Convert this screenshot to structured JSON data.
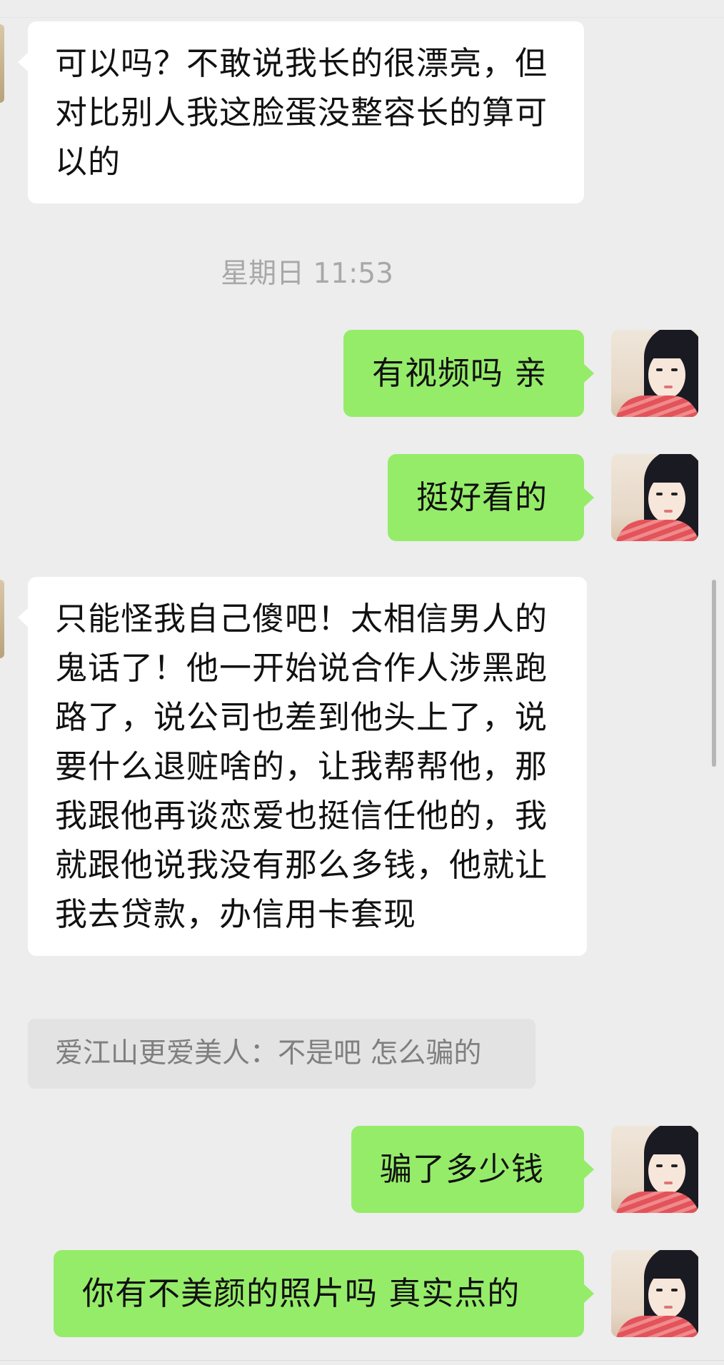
{
  "messages": {
    "m1": "可以吗？不敢说我长的很漂亮，但对比别人我这脸蛋没整容长的算可以的",
    "timestamp": "星期日 11:53",
    "m2": "有视频吗 亲",
    "m3": "挺好看的",
    "m4": "只能怪我自己傻吧！太相信男人的鬼话了！他一开始说合作人涉黑跑路了，说公司也差到他头上了，说要什么退赃啥的，让我帮帮他，那我跟他再谈恋爱也挺信任他的，我就跟他说我没有那么多钱，他就让我去贷款，办信用卡套现",
    "quote": "爱江山更爱美人：不是吧 怎么骗的",
    "m5": "骗了多少钱",
    "m6": "你有不美颜的照片吗 真实点的"
  },
  "colors": {
    "background": "#ededed",
    "sent_bubble": "#95ec69",
    "received_bubble": "#ffffff"
  }
}
